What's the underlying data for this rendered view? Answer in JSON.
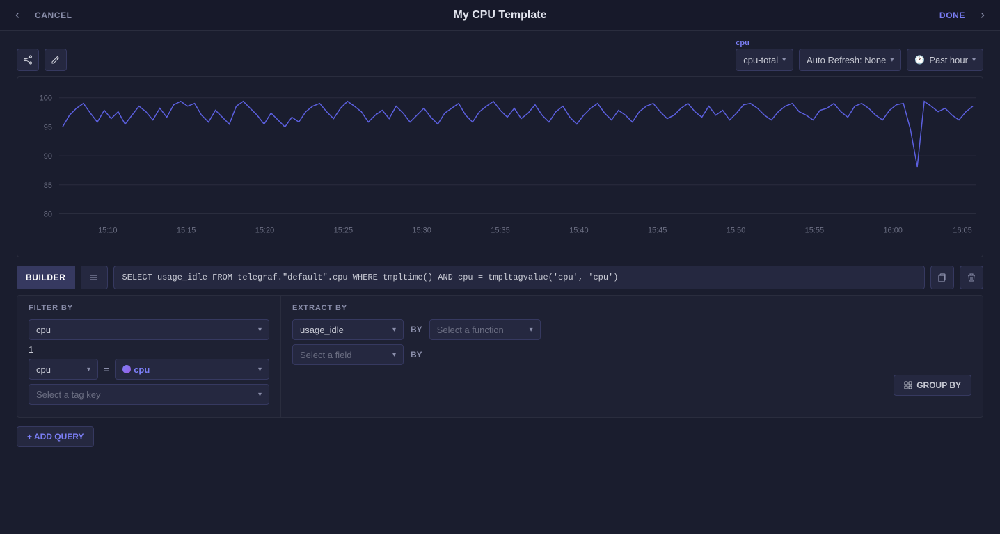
{
  "header": {
    "title": "My CPU Template",
    "cancel_label": "CANCEL",
    "done_label": "DONE"
  },
  "toolbar": {
    "cpu_tag_label": "cpu",
    "cpu_value": "cpu-total",
    "auto_refresh_label": "Auto Refresh: None",
    "time_label": "Past hour"
  },
  "chart": {
    "y_labels": [
      "100",
      "95",
      "90",
      "85",
      "80"
    ],
    "x_labels": [
      "15:10",
      "15:15",
      "15:20",
      "15:25",
      "15:30",
      "15:35",
      "15:40",
      "15:45",
      "15:50",
      "15:55",
      "16:00",
      "16:05"
    ]
  },
  "query_editor": {
    "builder_tab_label": "BUILDER",
    "script_tab_icon": "list-icon",
    "sql_text": "SELECT usage_idle FROM telegraf.\"default\".cpu WHERE tmpltime() AND cpu = tmpltagvalue('cpu', 'cpu')"
  },
  "filter_section": {
    "title": "FILTER BY",
    "measurement": "cpu",
    "filter_num": "1",
    "field": "cpu",
    "operator": "=",
    "tag_value": "cpu",
    "tag_key_placeholder": "Select a tag key"
  },
  "extract_section": {
    "title": "EXTRACT BY",
    "field1": "usage_idle",
    "by_label1": "BY",
    "function_placeholder": "Select a function",
    "field2_placeholder": "Select a field",
    "by_label2": "BY",
    "group_by_label": "GROUP BY"
  },
  "add_query": {
    "label": "+ ADD QUERY"
  }
}
